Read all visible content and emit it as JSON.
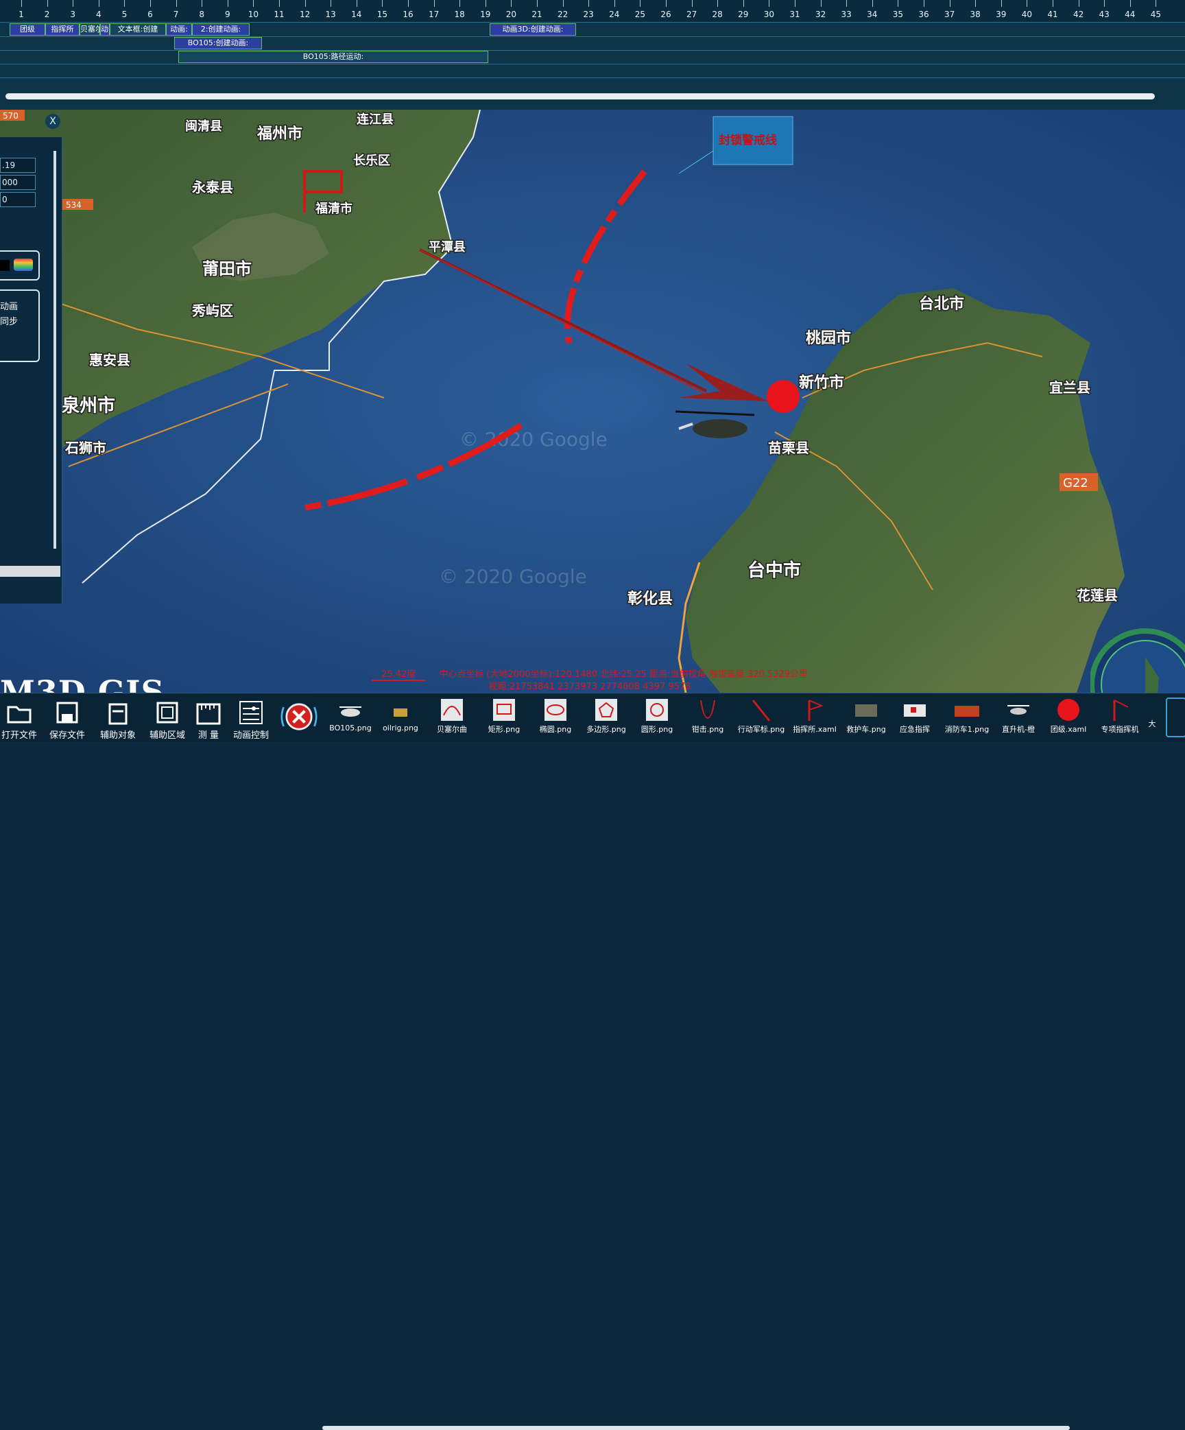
{
  "timeline": {
    "ticks": [
      "1",
      "2",
      "3",
      "4",
      "5",
      "6",
      "7",
      "8",
      "9",
      "10",
      "11",
      "12",
      "13",
      "14",
      "15",
      "16",
      "17",
      "18",
      "19",
      "20",
      "21",
      "22",
      "23",
      "24",
      "25",
      "26",
      "27",
      "28",
      "29",
      "30",
      "31",
      "32",
      "33",
      "34",
      "35",
      "36",
      "37",
      "38",
      "39",
      "40",
      "41",
      "42",
      "43",
      "44",
      "45"
    ],
    "track1": [
      "团级",
      "指挥所",
      "贝塞尔",
      "动画:",
      "文本框:创建",
      "动画:",
      "2:创建动画:"
    ],
    "track1_right": "动画3D:创建动画:",
    "track2": "BO105:创建动画:",
    "track3": "BO105:路径运动:"
  },
  "map": {
    "cities": [
      "闽清县",
      "福州市",
      "连江县",
      "长乐区",
      "永泰县",
      "福清市",
      "平潭县",
      "莆田市",
      "秀屿区",
      "惠安县",
      "泉州市",
      "石狮市",
      "台北市",
      "桃园市",
      "新竹市",
      "宜兰县",
      "苗栗县",
      "台中市",
      "彰化县",
      "花莲县"
    ],
    "road_badges": [
      "570",
      "534",
      "G22"
    ],
    "callout": "封锁警戒线",
    "watermarks": [
      "© 2020 Google",
      "© 2020 Google"
    ],
    "accent_red": "#e01b1b"
  },
  "left_panel": {
    "fields": [
      ".19",
      "000",
      "0"
    ],
    "options": [
      "动画",
      "同步"
    ],
    "close": "X"
  },
  "brand": "M3D GIS",
  "status": {
    "line1_tag": "25.42度",
    "line1": "中心点坐标 (大地2000坐标):120.1480 北纬:25.25 距离:当前视角 海拔高度:320.5329公里",
    "line2": "视距:21753841 2373973 2774608 4397 9578"
  },
  "toolbar": {
    "buttons": [
      {
        "label": "打开文件",
        "icon": "folder-icon"
      },
      {
        "label": "保存文件",
        "icon": "save-icon"
      },
      {
        "label": "辅助对象",
        "icon": "object-icon"
      },
      {
        "label": "辅助区域",
        "icon": "area-icon"
      },
      {
        "label": "测 量",
        "icon": "ruler-icon"
      },
      {
        "label": "动画控制",
        "icon": "sliders-icon"
      }
    ],
    "assets": [
      {
        "label": "BO105.png"
      },
      {
        "label": "oilrig.png"
      },
      {
        "label": "贝塞尔曲"
      },
      {
        "label": "矩形.png"
      },
      {
        "label": "椭圆.png"
      },
      {
        "label": "多边形.png"
      },
      {
        "label": "圆形.png"
      },
      {
        "label": "钳击.png"
      },
      {
        "label": "行动军标.png"
      },
      {
        "label": "指挥所.xaml"
      },
      {
        "label": "救护车.png"
      },
      {
        "label": "应急指挥"
      },
      {
        "label": "消防车1.png"
      },
      {
        "label": "直升机-橙"
      },
      {
        "label": "团级.xaml"
      },
      {
        "label": "专项指挥机"
      },
      {
        "label": "大"
      }
    ]
  }
}
